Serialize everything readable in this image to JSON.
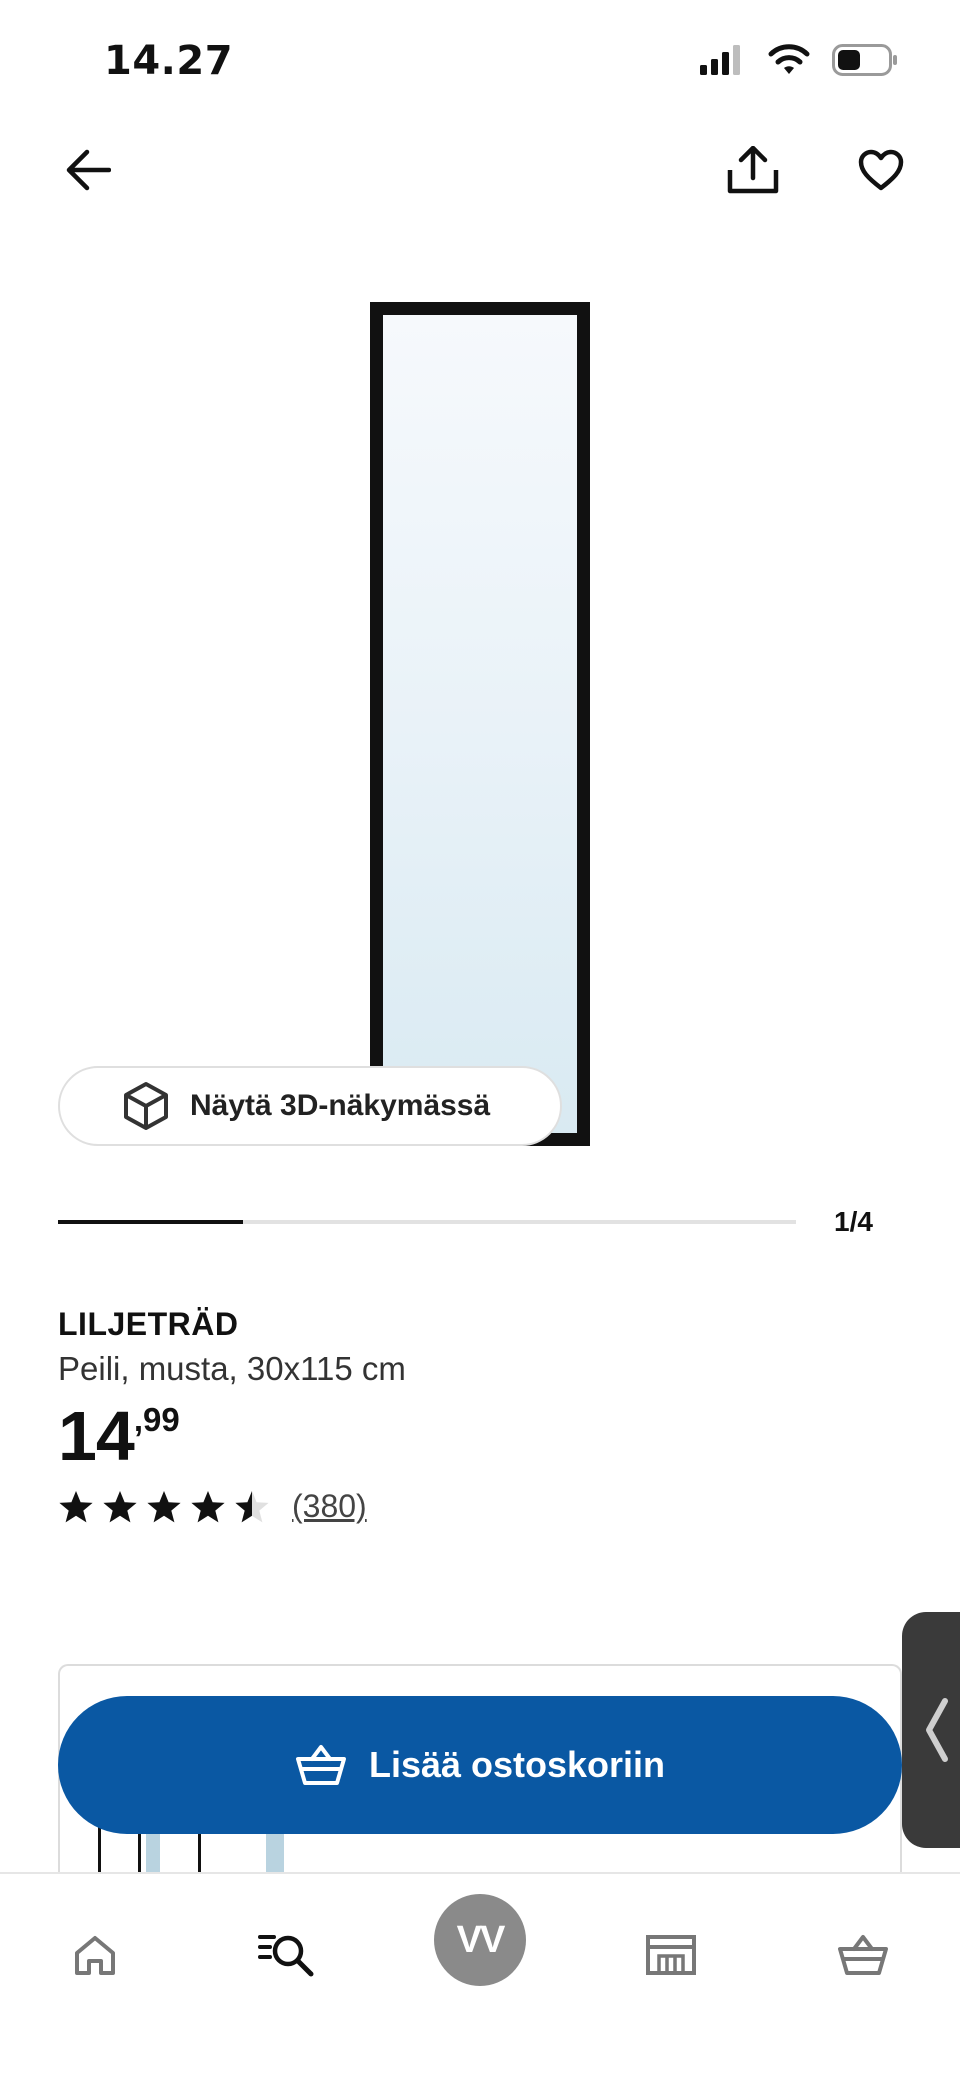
{
  "status_bar": {
    "time": "14.27",
    "icons": [
      "signal-icon",
      "wifi-icon",
      "battery-icon"
    ]
  },
  "top_nav": {
    "icons": [
      "back-arrow-icon",
      "share-icon",
      "heart-icon"
    ]
  },
  "product_image": {
    "view_3d_label": "Näytä 3D-näkymässä",
    "icon": "cube-icon"
  },
  "carousel": {
    "counter": "1/4",
    "current": 1,
    "total": 4
  },
  "product": {
    "name": "LILJETRÄD",
    "description": "Peili, musta, 30x115 cm",
    "price_integer": "14",
    "price_decimal": ",99",
    "rating_value": 4.5,
    "rating_max": 5,
    "review_count": "(380)"
  },
  "cart": {
    "add_label": "Lisää ostoskoriin",
    "icon": "basket-icon"
  },
  "bottom_nav": {
    "items": [
      {
        "name": "home",
        "icon": "home-icon"
      },
      {
        "name": "search",
        "icon": "search-icon"
      },
      {
        "name": "profile",
        "initials": "VV"
      },
      {
        "name": "store",
        "icon": "store-icon"
      },
      {
        "name": "cart",
        "icon": "cart-icon"
      }
    ]
  },
  "colors": {
    "primary_blue": "#0a58a3",
    "text": "#111111",
    "avatar_bg": "#8a8a8a"
  }
}
